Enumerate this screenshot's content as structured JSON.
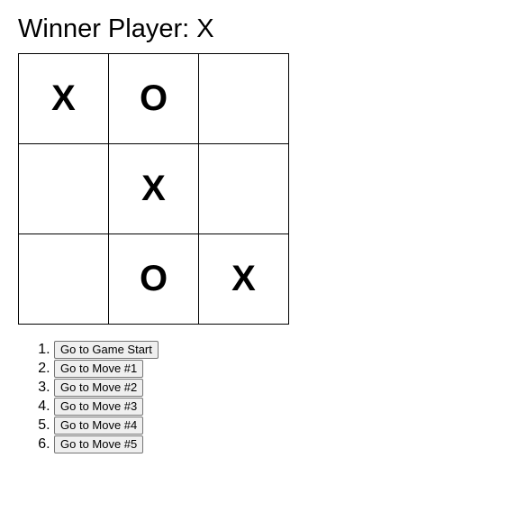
{
  "status": "Winner Player: X",
  "board": [
    "X",
    "O",
    "",
    "",
    "X",
    "",
    "",
    "O",
    "X"
  ],
  "moves": [
    "Go to Game Start",
    "Go to Move #1",
    "Go to Move #2",
    "Go to Move #3",
    "Go to Move #4",
    "Go to Move #5"
  ]
}
